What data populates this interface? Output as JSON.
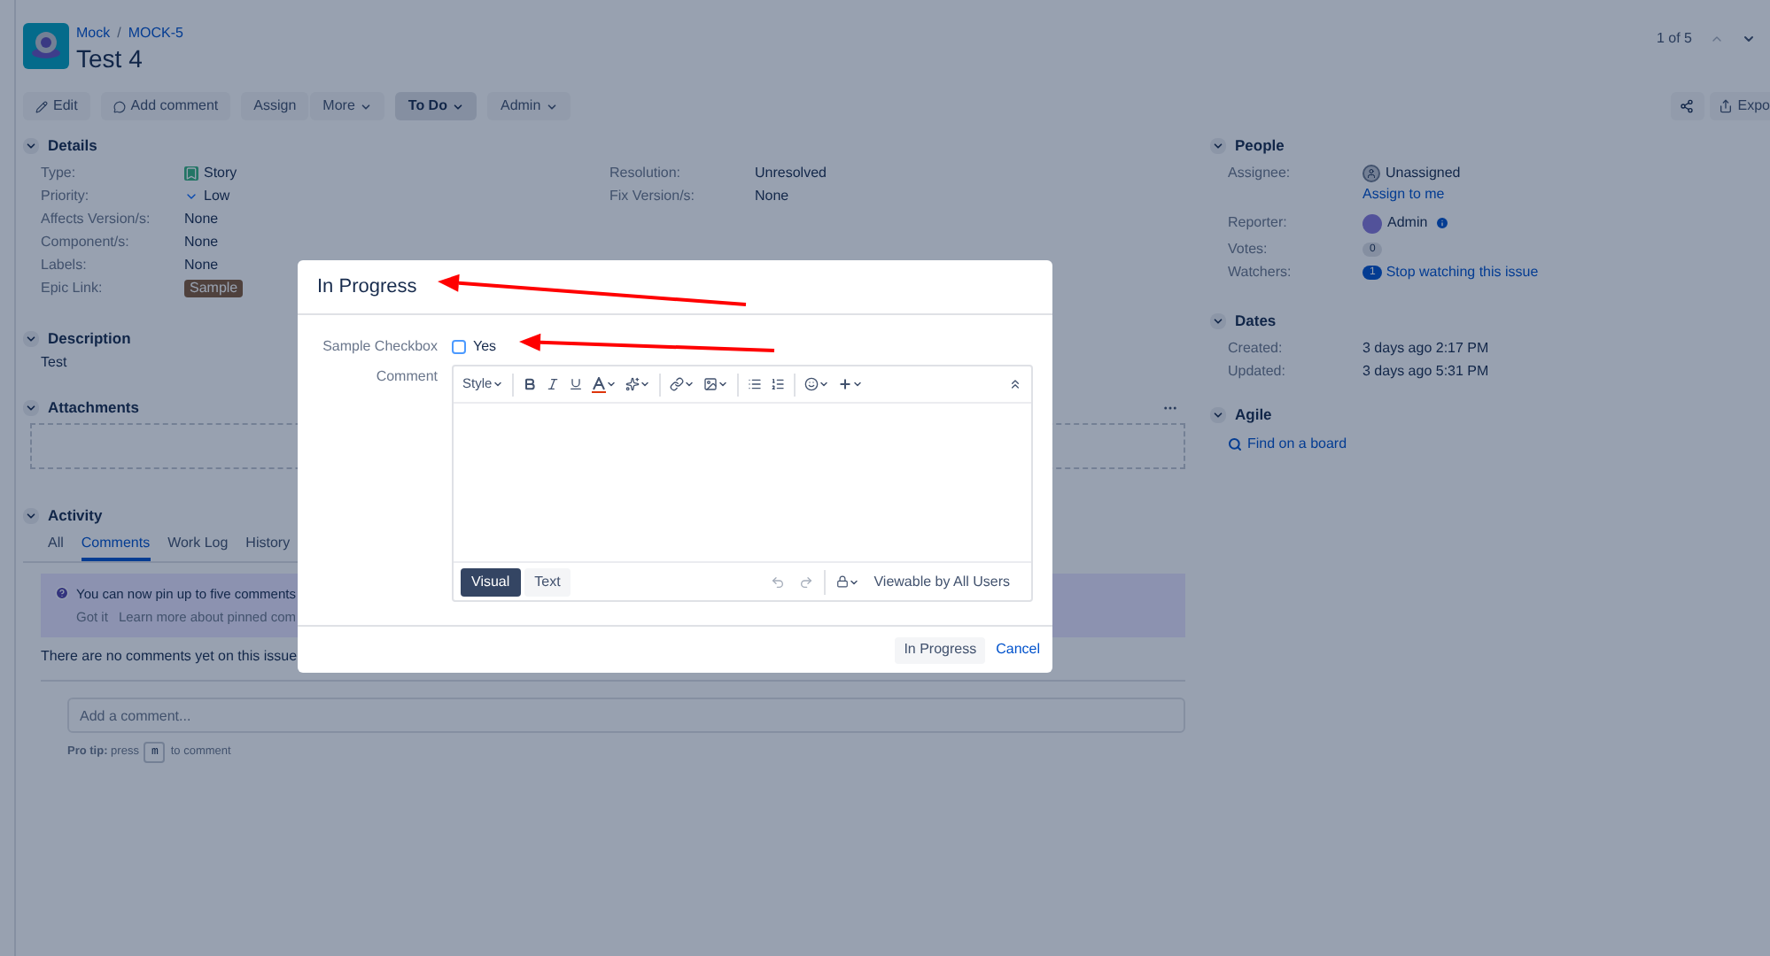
{
  "breadcrumbs": [
    {
      "label": "Mock"
    },
    {
      "label": "MOCK-5"
    }
  ],
  "breadcrumb_separator": "/",
  "issue_title": "Test 4",
  "pager": "1 of 5",
  "toolbar": [
    {
      "label": "Edit",
      "kind": "edit"
    },
    {
      "label": "Add comment",
      "kind": "comment"
    },
    {
      "label": "Assign",
      "kind": "plain"
    },
    {
      "label": "More",
      "kind": "dropdown"
    },
    {
      "label": "To Do",
      "kind": "status"
    },
    {
      "label": "Admin",
      "kind": "dropdown"
    }
  ],
  "export_button": "Expo",
  "details": {
    "title": "Details",
    "expanded": true,
    "fields": [
      {
        "label": "Type:",
        "value": "Story",
        "kind": "type"
      },
      {
        "label": "Priority:",
        "value": "Low",
        "kind": "priority"
      },
      {
        "label": "Affects Version/s:",
        "value": "None",
        "kind": "text"
      },
      {
        "label": "Component/s:",
        "value": "None",
        "kind": "text"
      },
      {
        "label": "Labels:",
        "value": "None",
        "kind": "text"
      },
      {
        "label": "Epic Link:",
        "value": "Sample",
        "kind": "lozenge"
      }
    ],
    "fields_right": [
      {
        "label": "Resolution:",
        "value": "Unresolved"
      },
      {
        "label": "Fix Version/s:",
        "value": "None"
      }
    ]
  },
  "description": {
    "title": "Description",
    "expanded": true,
    "text": "Test"
  },
  "attachments": {
    "title": "Attachments",
    "expanded": true
  },
  "activity": {
    "title": "Activity",
    "expanded": true,
    "tabs": [
      {
        "label": "All",
        "selected": false
      },
      {
        "label": "Comments",
        "selected": true
      },
      {
        "label": "Work Log",
        "selected": false
      },
      {
        "label": "History",
        "selected": false
      }
    ],
    "banner": {
      "text": "You can now pin up to five comments",
      "actions": [
        "Got it",
        "Learn more about pinned com"
      ]
    },
    "empty_text": "There are no comments yet on this issue.",
    "comment_field": {
      "placeholder": "Add a comment..."
    },
    "pro_tip": {
      "text": "**Pro tip:** press",
      "key": "m",
      "suffix": "to comment"
    }
  },
  "people": {
    "title": "People",
    "expanded": true,
    "assignee": {
      "label": "Assignee:",
      "value": "Unassigned",
      "action": "Assign to me"
    },
    "reporter": {
      "label": "Reporter:",
      "value": "Admin"
    },
    "votes": {
      "label": "Votes:",
      "count": "0"
    },
    "watchers": {
      "label": "Watchers:",
      "count": "1",
      "action": "Stop watching this issue"
    }
  },
  "dates": {
    "title": "Dates",
    "expanded": true,
    "fields": [
      {
        "label": "Created:",
        "value": "3 days ago 2:17 PM"
      },
      {
        "label": "Updated:",
        "value": "3 days ago 5:31 PM"
      }
    ]
  },
  "agile": {
    "title": "Agile",
    "expanded": true,
    "link": "Find on a board"
  },
  "dialog": {
    "title": "In Progress",
    "checkbox_field": {
      "label": "Sample Checkbox",
      "option": "Yes",
      "checked": false
    },
    "comment_label": "Comment",
    "editor": {
      "style_menu": "Style",
      "modes": [
        {
          "label": "Visual",
          "selected": true
        },
        {
          "label": "Text",
          "selected": false
        }
      ],
      "visibility": "Viewable by All Users"
    },
    "buttons": [
      {
        "label": "In Progress",
        "kind": "primary"
      },
      {
        "label": "Cancel",
        "kind": "link"
      }
    ]
  }
}
